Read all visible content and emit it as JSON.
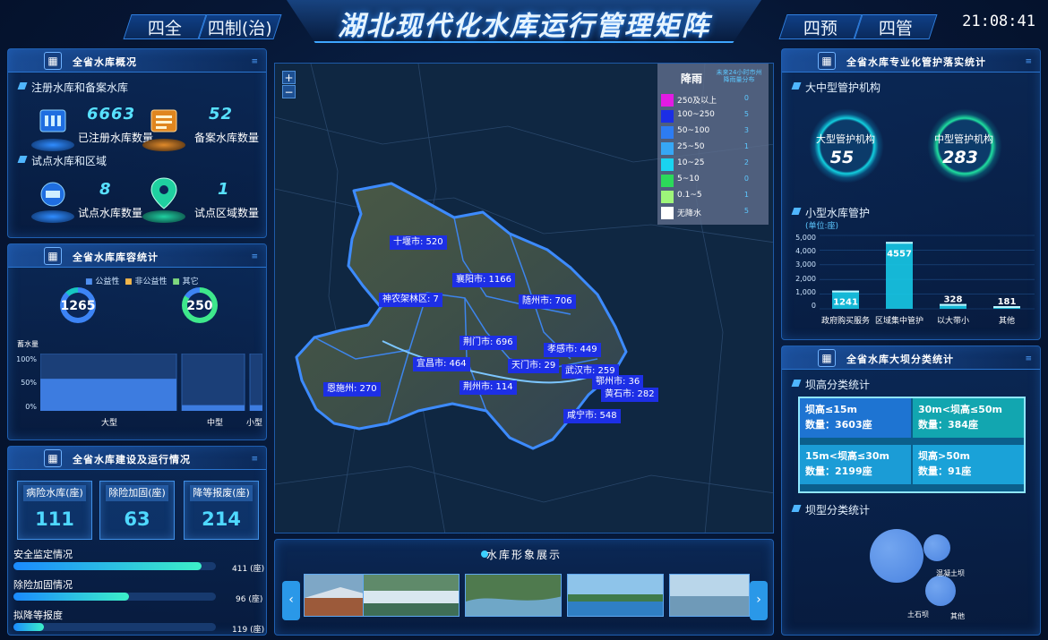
{
  "header": {
    "title": "湖北现代化水库运行管理矩阵",
    "tabs_left": [
      "四全",
      "四制(治)"
    ],
    "tabs_right": [
      "四预",
      "四管"
    ],
    "clock": "21:08:41"
  },
  "overview": {
    "title": "全省水库概况",
    "sub1": "注册水库和备案水库",
    "registered": {
      "value": "6663",
      "label": "已注册水库数量"
    },
    "filed": {
      "value": "52",
      "label": "备案水库数量"
    },
    "sub2": "试点水库和区域",
    "pilot_reservoirs": {
      "value": "8",
      "label": "试点水库数量"
    },
    "pilot_regions": {
      "value": "1",
      "label": "试点区域数量"
    }
  },
  "capacity": {
    "title": "全省水库库容统计",
    "legend": [
      "公益性",
      "非公益性",
      "其它"
    ],
    "ring1": "1265",
    "ring2": "250",
    "storage_label": "蓄水量",
    "y_ticks": [
      "100%",
      "50%",
      "0%"
    ],
    "categories": [
      "大型",
      "中型",
      "小型"
    ]
  },
  "construction": {
    "title": "全省水库建设及运行情况",
    "stats": [
      {
        "label": "病险水库(座)",
        "value": "111"
      },
      {
        "label": "除险加固(座)",
        "value": "63"
      },
      {
        "label": "降等报废(座)",
        "value": "214"
      }
    ],
    "bars": [
      {
        "label": "安全监定情况",
        "value": "411",
        "unit": "(座)",
        "fraction": 0.93
      },
      {
        "label": "除险加固情况",
        "value": "96",
        "unit": "(座)",
        "fraction": 0.57
      },
      {
        "label": "拟降等报度",
        "value": "119",
        "unit": "(座)",
        "fraction": 0.15
      }
    ]
  },
  "map": {
    "zoom_in": "+",
    "zoom_out": "−",
    "legend": {
      "title": "降雨",
      "note": "未来24小时市州降雨量分布",
      "rows": [
        {
          "label": "250及以上",
          "count": "0",
          "color": "#e21be3"
        },
        {
          "label": "100~250",
          "count": "5",
          "color": "#1b2ee6"
        },
        {
          "label": "50~100",
          "count": "3",
          "color": "#2d7cf3"
        },
        {
          "label": "25~50",
          "count": "1",
          "color": "#36a7f5"
        },
        {
          "label": "10~25",
          "count": "2",
          "color": "#19d4f0"
        },
        {
          "label": "5~10",
          "count": "0",
          "color": "#2bd95a"
        },
        {
          "label": "0.1~5",
          "count": "1",
          "color": "#9ef57a"
        },
        {
          "label": "无降水",
          "count": "5",
          "color": "#ffffff"
        }
      ]
    },
    "cities": [
      "十堰市: 520",
      "襄阳市: 1166",
      "神农架林区: 7",
      "随州市: 706",
      "荆门市: 696",
      "孝感市: 449",
      "宜昌市: 464",
      "天门市: 29",
      "武汉市: 259",
      "恩施州: 270",
      "荆州市: 114",
      "鄂州市: 36",
      "黄石市: 282",
      "咸宁市: 548"
    ]
  },
  "gallery": {
    "title": "水库形象展示",
    "prev": "‹",
    "next": "›"
  },
  "management": {
    "title": "全省水库专业化管护落实统计",
    "sub1": "大中型管护机构",
    "large": {
      "label": "大型管护机构",
      "value": "55"
    },
    "medium": {
      "label": "中型管护机构",
      "value": "283"
    },
    "sub2": "小型水库管护",
    "unit": "(单位:座)",
    "y_ticks": [
      "5,000",
      "4,000",
      "3,000",
      "2,000",
      "1,000",
      "0"
    ]
  },
  "dam": {
    "title": "全省水库大坝分类统计",
    "sub1": "坝高分类统计",
    "cells": [
      {
        "range": "坝高≤15m",
        "count": "数量：3603座"
      },
      {
        "range": "30m<坝高≤50m",
        "count": "数量：384座"
      },
      {
        "range": "15m<坝高≤30m",
        "count": "数量：2199座"
      },
      {
        "range": "坝高>50m",
        "count": "数量：91座"
      }
    ],
    "sub2": "坝型分类统计",
    "bubble_labels": [
      "混凝土坝",
      "土石坝",
      "其他"
    ]
  },
  "chart_data": [
    {
      "type": "area",
      "ylabel": "蓄水量",
      "categories": [
        "大型",
        "中型",
        "小型"
      ],
      "values": [
        0.56,
        0.1,
        0.1
      ],
      "ylim": [
        0,
        1
      ],
      "unit": "%"
    },
    {
      "type": "bar",
      "ylabel": "(单位:座)",
      "categories": [
        "政府购买服务",
        "区域集中管护",
        "以大带小",
        "其他"
      ],
      "values": [
        1241,
        4557,
        328,
        181
      ],
      "ylim": [
        0,
        5000
      ]
    }
  ],
  "colors": {
    "accent": "#58e1ff",
    "brand": "#1f5fb0",
    "rain_high": "#1d2fe6"
  }
}
